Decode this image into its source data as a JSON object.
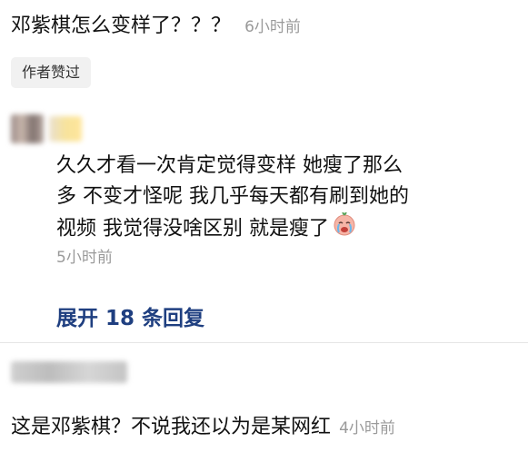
{
  "top_comment": {
    "text": "邓紫棋怎么变样了？？？",
    "time": "6小时前"
  },
  "author_badge": "作者赞过",
  "reply": {
    "lines": [
      "久久才看一次肯定觉得变样 她瘦了那么",
      "多 不变才怪呢 我几乎每天都有刷到她的",
      "视频 我觉得没啥区别 就是瘦了"
    ],
    "emoji": "crying-face-emoji",
    "time": "5小时前"
  },
  "expand_replies": "展开 18 条回复",
  "bottom_comment": {
    "text": "这是邓紫棋？不说我还以为是某网红",
    "time": "4小时前"
  }
}
